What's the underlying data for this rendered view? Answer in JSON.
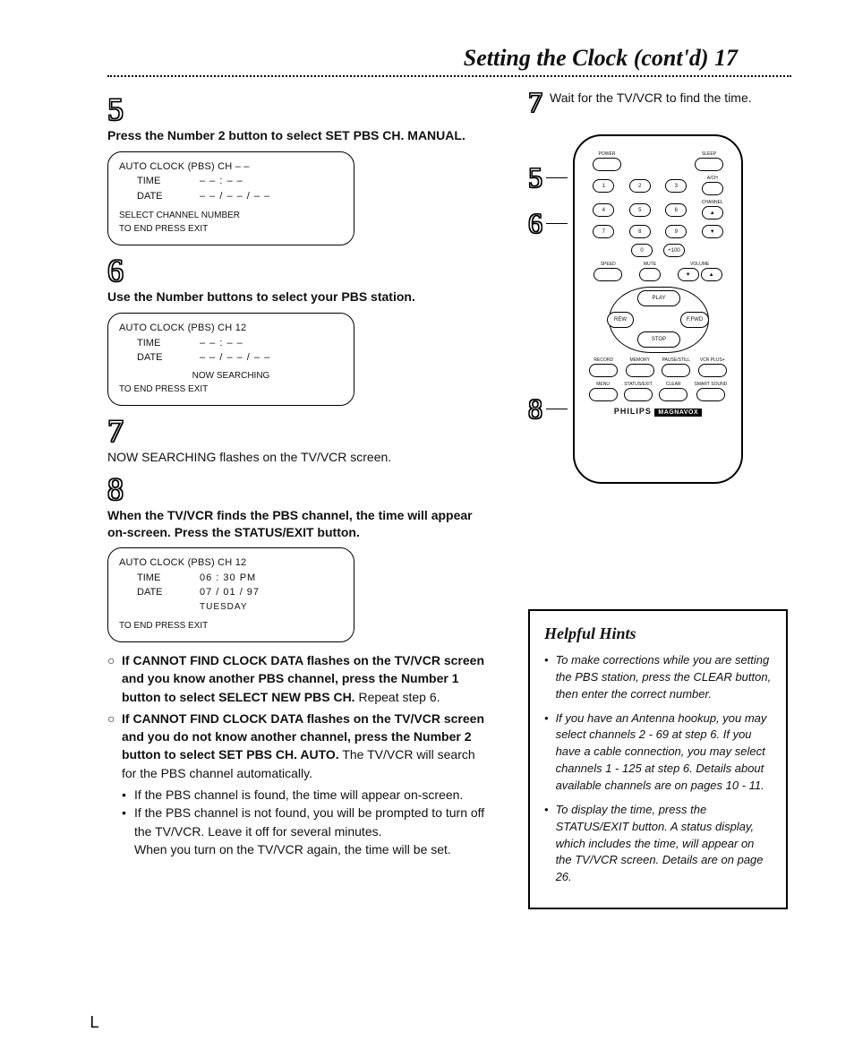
{
  "header": {
    "title": "Setting the Clock (cont'd)  17"
  },
  "steps": {
    "s5": {
      "num": "5",
      "text": "Press the Number 2 button to select SET PBS CH. MANUAL."
    },
    "s6": {
      "num": "6",
      "text": "Use the Number buttons to select your PBS station."
    },
    "s7": {
      "num": "7",
      "text": "NOW SEARCHING flashes on the TV/VCR screen."
    },
    "s8": {
      "num": "8",
      "text": "When the TV/VCR finds the PBS channel, the time will appear on-screen. Press the STATUS/EXIT button."
    },
    "r7": {
      "num": "7",
      "text": "Wait for the TV/VCR to find the time."
    }
  },
  "osd1": {
    "title": "AUTO CLOCK (PBS) CH – –",
    "time_lbl": "TIME",
    "time_val": "– – : – –",
    "date_lbl": "DATE",
    "date_val": "– – / – – / – –",
    "line1": "SELECT CHANNEL NUMBER",
    "line2": "TO END PRESS EXIT"
  },
  "osd2": {
    "title": "AUTO CLOCK (PBS) CH 12",
    "time_lbl": "TIME",
    "time_val": "– – : – –",
    "date_lbl": "DATE",
    "date_val": "– – / – – / – –",
    "line1": "NOW SEARCHING",
    "line2": "TO END PRESS EXIT"
  },
  "osd3": {
    "title": "AUTO CLOCK (PBS) CH 12",
    "time_lbl": "TIME",
    "time_val": "06 : 30 PM",
    "date_lbl": "DATE",
    "date_val": "07 / 01 / 97",
    "date_day": "TUESDAY",
    "line2": "TO END PRESS EXIT"
  },
  "callouts": {
    "c5": "5",
    "c6": "6",
    "c8": "8"
  },
  "remote": {
    "top_labels": {
      "power": "POWER",
      "sleep": "SLEEP",
      "atch": "A/CH"
    },
    "numbers": {
      "n1": "1",
      "n2": "2",
      "n3": "3",
      "n4": "4",
      "n5": "5",
      "n6": "6",
      "n7": "7",
      "n8": "8",
      "n9": "9",
      "n0": "0",
      "n100": "+100"
    },
    "channel_lbl": "CHANNEL",
    "ch_up": "▲",
    "ch_dn": "▼",
    "speed_lbl": "SPEED",
    "mute_lbl": "MUTE",
    "volume_lbl": "VOLUME",
    "vol_dn": "▼",
    "vol_up": "▲",
    "play": "PLAY",
    "stop": "STOP",
    "rew": "REW",
    "ffwd": "F.FWD",
    "row_a": {
      "a1": "RECORD",
      "a2": "MEMORY",
      "a3": "PAUSE/STILL",
      "a4": "VCR PLUS+"
    },
    "row_b": {
      "b1": "MENU",
      "b2": "STATUS/EXIT",
      "b3": "CLEAR",
      "b4": "SMART SOUND"
    },
    "brand1": "PHILIPS",
    "brand2": "MAGNAVOX"
  },
  "notes": {
    "n1_bold1": "If CANNOT FIND CLOCK DATA flashes on the TV/VCR screen and you know another PBS channel, press the Number 1 button to select SELECT NEW PBS CH.",
    "n1_tail": " Repeat step 6.",
    "n2_bold1": "If CANNOT FIND CLOCK DATA flashes on the TV/VCR screen and you do not know another channel, press the Number 2 button to select SET PBS CH. AUTO.",
    "n2_tail": " The TV/VCR will search for the PBS channel automatically.",
    "sub1": "If the PBS channel is found, the time will appear on-screen.",
    "sub2": "If the PBS channel is not found, you will be prompted to turn off the TV/VCR. Leave it off for several minutes.",
    "sub3": "When you turn on the TV/VCR again, the time will be set."
  },
  "hints": {
    "title": "Helpful Hints",
    "h1": "To make corrections while you are setting the PBS station, press the CLEAR button, then enter the correct number.",
    "h2": "If you have an Antenna hookup, you may select channels 2 - 69 at step 6. If you have a cable connection, you may select channels 1 - 125 at step 6. Details about available channels are on pages 10 - 11.",
    "h3": "To display the time, press the STATUS/EXIT button. A status display, which includes the time, will appear on the TV/VCR screen. Details are on page 26."
  },
  "corner": "L"
}
